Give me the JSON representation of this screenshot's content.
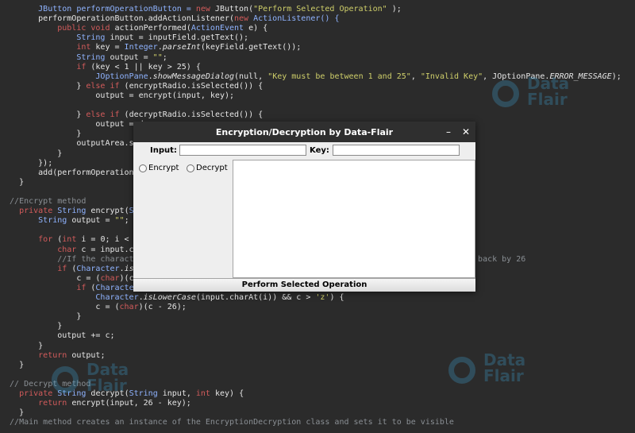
{
  "code_lines": [
    [
      {
        "t": "        JButton performOperationButton = ",
        "c": "type"
      },
      {
        "t": "new",
        "c": "kw"
      },
      {
        "t": " JButton(",
        "c": ""
      },
      {
        "t": "\"Perform Selected Operation\"",
        "c": "str"
      },
      {
        "t": " );",
        "c": ""
      }
    ],
    [
      {
        "t": "        performOperationButton.addActionListener(",
        "c": ""
      },
      {
        "t": "new",
        "c": "kw"
      },
      {
        "t": " ActionListener() {",
        "c": "type"
      }
    ],
    [
      {
        "t": "            ",
        "c": ""
      },
      {
        "t": "public void",
        "c": "kw"
      },
      {
        "t": " actionPerformed(",
        "c": ""
      },
      {
        "t": "ActionEvent",
        "c": "type"
      },
      {
        "t": " e) {",
        "c": ""
      }
    ],
    [
      {
        "t": "                String",
        "c": "type"
      },
      {
        "t": " input = inputField.getText();",
        "c": ""
      }
    ],
    [
      {
        "t": "                int",
        "c": "kw"
      },
      {
        "t": " key = ",
        "c": ""
      },
      {
        "t": "Integer",
        "c": "type"
      },
      {
        "t": ".",
        "c": ""
      },
      {
        "t": "parseInt",
        "c": "ital"
      },
      {
        "t": "(keyField.getText());",
        "c": ""
      }
    ],
    [
      {
        "t": "                String",
        "c": "type"
      },
      {
        "t": " output = ",
        "c": ""
      },
      {
        "t": "\"\"",
        "c": "str"
      },
      {
        "t": ";",
        "c": ""
      }
    ],
    [
      {
        "t": "                if",
        "c": "kw"
      },
      {
        "t": " (key < 1 || key > 25) {",
        "c": ""
      }
    ],
    [
      {
        "t": "                    JOptionPane",
        "c": "type"
      },
      {
        "t": ".",
        "c": ""
      },
      {
        "t": "showMessageDialog",
        "c": "ital"
      },
      {
        "t": "(null, ",
        "c": ""
      },
      {
        "t": "\"Key must be between 1 and 25\"",
        "c": "str"
      },
      {
        "t": ", ",
        "c": ""
      },
      {
        "t": "\"Invalid Key\"",
        "c": "str"
      },
      {
        "t": ", JOptionPane.",
        "c": ""
      },
      {
        "t": "ERROR_MESSAGE",
        "c": "ital"
      },
      {
        "t": ");",
        "c": ""
      }
    ],
    [
      {
        "t": "                } ",
        "c": ""
      },
      {
        "t": "else if",
        "c": "kw"
      },
      {
        "t": " (encryptRadio.isSelected()) {",
        "c": ""
      }
    ],
    [
      {
        "t": "                    output = encrypt(input, key);",
        "c": ""
      }
    ],
    [
      {
        "t": "",
        "c": ""
      }
    ],
    [
      {
        "t": "                } ",
        "c": ""
      },
      {
        "t": "else if",
        "c": "kw"
      },
      {
        "t": " (decryptRadio.isSelected()) {",
        "c": ""
      }
    ],
    [
      {
        "t": "                    output = d",
        "c": ""
      }
    ],
    [
      {
        "t": "                }",
        "c": ""
      }
    ],
    [
      {
        "t": "                outputArea.set",
        "c": ""
      }
    ],
    [
      {
        "t": "            }",
        "c": ""
      }
    ],
    [
      {
        "t": "        });",
        "c": ""
      }
    ],
    [
      {
        "t": "        add(performOperationBu",
        "c": ""
      }
    ],
    [
      {
        "t": "    }",
        "c": ""
      }
    ],
    [
      {
        "t": "",
        "c": ""
      }
    ],
    [
      {
        "t": "  //Encrypt method",
        "c": "cm"
      }
    ],
    [
      {
        "t": "    ",
        "c": ""
      },
      {
        "t": "private",
        "c": "kw"
      },
      {
        "t": " String",
        "c": "type"
      },
      {
        "t": " encrypt(",
        "c": ""
      },
      {
        "t": "Strin",
        "c": "type"
      }
    ],
    [
      {
        "t": "        String",
        "c": "type"
      },
      {
        "t": " output = ",
        "c": ""
      },
      {
        "t": "\"\"",
        "c": "str"
      },
      {
        "t": ";",
        "c": ""
      }
    ],
    [
      {
        "t": "",
        "c": ""
      }
    ],
    [
      {
        "t": "        for",
        "c": "kw"
      },
      {
        "t": " (",
        "c": ""
      },
      {
        "t": "int",
        "c": "kw"
      },
      {
        "t": " i = 0; i < in",
        "c": ""
      }
    ],
    [
      {
        "t": "            char",
        "c": "kw"
      },
      {
        "t": " c = input.cha",
        "c": ""
      }
    ],
    [
      {
        "t": "            //If the character",
        "c": "cm"
      },
      {
        "t": "                                                                   it back by 26",
        "c": "cm"
      }
    ],
    [
      {
        "t": "            if",
        "c": "kw"
      },
      {
        "t": " (",
        "c": ""
      },
      {
        "t": "Character",
        "c": "type"
      },
      {
        "t": ".",
        "c": ""
      },
      {
        "t": "isLe",
        "c": "ital"
      }
    ],
    [
      {
        "t": "                c = (",
        "c": ""
      },
      {
        "t": "char",
        "c": "kw"
      },
      {
        "t": ")(c +",
        "c": ""
      }
    ],
    [
      {
        "t": "                if",
        "c": "kw"
      },
      {
        "t": " (",
        "c": ""
      },
      {
        "t": "Character",
        "c": "type"
      },
      {
        "t": ".",
        "c": ""
      }
    ],
    [
      {
        "t": "                    Character",
        "c": "type"
      },
      {
        "t": ".",
        "c": ""
      },
      {
        "t": "isLowerCase",
        "c": "ital"
      },
      {
        "t": "(input.charAt(i)) && c > ",
        "c": ""
      },
      {
        "t": "'z'",
        "c": "str"
      },
      {
        "t": ") {",
        "c": ""
      }
    ],
    [
      {
        "t": "                    c = (",
        "c": ""
      },
      {
        "t": "char",
        "c": "kw"
      },
      {
        "t": ")(c - 26);",
        "c": ""
      }
    ],
    [
      {
        "t": "                }",
        "c": ""
      }
    ],
    [
      {
        "t": "            }",
        "c": ""
      }
    ],
    [
      {
        "t": "            output += c;",
        "c": ""
      }
    ],
    [
      {
        "t": "        }",
        "c": ""
      }
    ],
    [
      {
        "t": "        return",
        "c": "kw"
      },
      {
        "t": " output;",
        "c": ""
      }
    ],
    [
      {
        "t": "    }",
        "c": ""
      }
    ],
    [
      {
        "t": "",
        "c": ""
      }
    ],
    [
      {
        "t": "  // ",
        "c": "cm"
      },
      {
        "t": "Decrypt method",
        "c": "cm"
      }
    ],
    [
      {
        "t": "    ",
        "c": ""
      },
      {
        "t": "private",
        "c": "kw"
      },
      {
        "t": " String",
        "c": "type"
      },
      {
        "t": " decrypt(",
        "c": ""
      },
      {
        "t": "String",
        "c": "type"
      },
      {
        "t": " input, ",
        "c": ""
      },
      {
        "t": "int",
        "c": "kw"
      },
      {
        "t": " key) {",
        "c": ""
      }
    ],
    [
      {
        "t": "        return",
        "c": "kw"
      },
      {
        "t": " encrypt(input, 26 - key);",
        "c": ""
      }
    ],
    [
      {
        "t": "    }",
        "c": ""
      }
    ],
    [
      {
        "t": "  //Main method creates an instance of the EncryptionDecryption class and sets it to be visible",
        "c": "cm"
      }
    ]
  ],
  "watermark": {
    "line1": "Data",
    "line2": "Flair"
  },
  "dialog": {
    "title": "Encryption/Decryption by Data-Flair",
    "minimize_label": "–",
    "close_label": "✕",
    "input_label": "Input:",
    "input_value": "",
    "key_label": "Key:",
    "key_value": "",
    "encrypt_label": "Encrypt",
    "decrypt_label": "Decrypt",
    "output_value": "",
    "perform_label": "Perform Selected Operation"
  },
  "colors": {
    "editor_bg": "#2b2b2b",
    "keyword": "#d25b5b",
    "type": "#8fb3ff",
    "string": "#cfcf6a",
    "comment": "#8a8f94",
    "watermark": "#3fa4d8"
  }
}
